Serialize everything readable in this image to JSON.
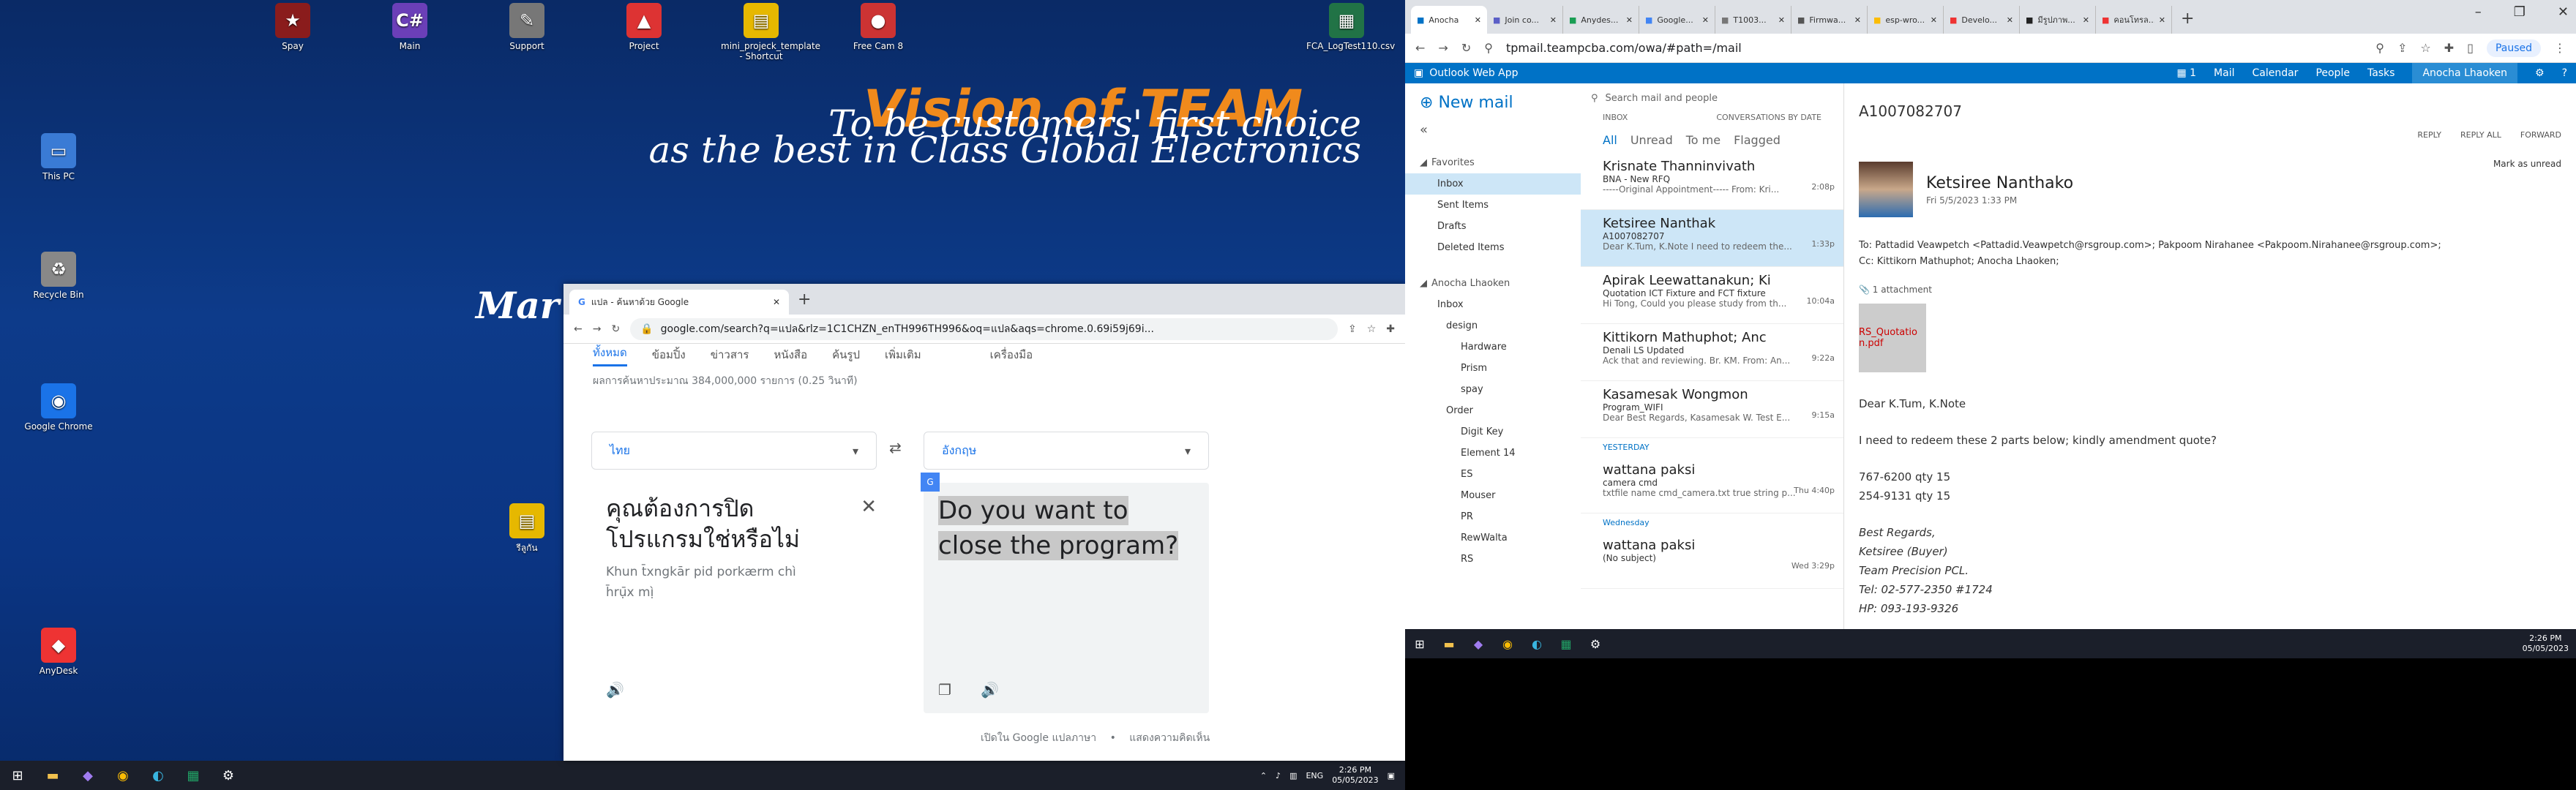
{
  "desktop": {
    "icons": [
      {
        "label": "Spay",
        "glyph": "★",
        "color": "#8a1c1c"
      },
      {
        "label": "Main",
        "glyph": "C#",
        "color": "#6b3fb8"
      },
      {
        "label": "Support",
        "glyph": "✎",
        "color": "#777"
      },
      {
        "label": "Project",
        "glyph": "▲",
        "color": "#d33"
      },
      {
        "label": "mini_projeck_template - Shortcut",
        "glyph": "▤",
        "color": "#e6b800"
      },
      {
        "label": "Free Cam 8",
        "glyph": "●",
        "color": "#c33"
      },
      {
        "label": "FCA_LogTest110.csv",
        "glyph": "▦",
        "color": "#217346"
      },
      {
        "label": "This PC",
        "glyph": "▭",
        "color": "#3a7bd5"
      },
      {
        "label": "Recycle Bin",
        "glyph": "♻",
        "color": "#888"
      },
      {
        "label": "Google Chrome",
        "glyph": "◉",
        "color": "#1a73e8"
      },
      {
        "label": "รีลูกัน",
        "glyph": "▤",
        "color": "#e6b800"
      },
      {
        "label": "AnyDesk",
        "glyph": "◆",
        "color": "#e33"
      }
    ],
    "wallpaper": {
      "headline": "Vision of TEAM",
      "line1": "To be customers' first choice",
      "line2": "as the best in Class Global Electronics",
      "line3": "Mar"
    }
  },
  "translate_window": {
    "tab_title": "แปล - ค้นหาด้วย Google",
    "url": "google.com/search?q=แปล&rlz=1C1CHZN_enTH996TH996&oq=แปล&aqs=chrome.0.69i59j69i...",
    "nav": [
      "ทั้งหมด",
      "ข้อมปิ้ง",
      "ข่าวสาร",
      "หนังสือ",
      "ค้นรูป",
      "เพิ่มเติม",
      "เครื่องมือ"
    ],
    "stats": "ผลการค้นหาประมาณ 384,000,000 รายการ (0.25 วินาที)",
    "source_lang": "ไทย",
    "target_lang": "อังกฤษ",
    "source_text": "คุณต้องการปิดโปรแกรมใช่หรือไม่",
    "transliteration": "Khun t̄xngkār pid porkærm chı̀ h̄rụ̄x mị̀",
    "translated_text": "Do you want to close the program?",
    "footer_open": "เปิดใน Google แปลภาษา",
    "footer_feedback": "แสดงความคิดเห็น"
  },
  "left_taskbar": {
    "time": "2:26 PM",
    "date": "05/05/2023",
    "lang": "ENG"
  },
  "right_browser": {
    "tabs": [
      "Anocha",
      "Join co...",
      "Anydes...",
      "Google...",
      "T1003...",
      "Firmwa...",
      "esp-wro...",
      "Develo...",
      "มีรูปภาพ...",
      "คอนโทรล..."
    ],
    "url": "tpmail.teampcba.com/owa/#path=/mail",
    "paused_label": "Paused"
  },
  "owa": {
    "app_title": "Outlook Web App",
    "nav": [
      "Mail",
      "Calendar",
      "People",
      "Tasks"
    ],
    "user": "Anocha Lhaoken",
    "new_mail": "New mail",
    "favorites_label": "Favorites",
    "favorites": [
      "Inbox",
      "Sent Items",
      "Drafts",
      "Deleted Items"
    ],
    "account": "Anocha Lhaoken",
    "tree": [
      "Inbox",
      "design",
      "Hardware",
      "Prism",
      "spay",
      "Order",
      "Digit Key",
      "Element 14",
      "ES",
      "Mouser",
      "PR",
      "RewWalta",
      "RS"
    ],
    "search_placeholder": "Search mail and people",
    "list_inbox": "INBOX",
    "list_sort": "CONVERSATIONS BY DATE",
    "filters": [
      "All",
      "Unread",
      "To me",
      "Flagged"
    ],
    "messages": [
      {
        "from": "Krisnate Thanninvivath",
        "subject": "BNA - New RFQ",
        "preview": "-----Original Appointment----- From: Kri...",
        "time": "2:08p"
      },
      {
        "from": "Ketsiree Nanthak",
        "subject": "A1007082707",
        "preview": "Dear K.Tum, K.Note I need to redeem the...",
        "time": "1:33p"
      },
      {
        "from": "Apirak Leewattanakun; Ki",
        "subject": "Quotation ICT Fixture and FCT fixture",
        "preview": "Hi Tong, Could you please study from th...",
        "time": "10:04a"
      },
      {
        "from": "Kittikorn Mathuphot; Anc",
        "subject": "Denali LS Updated",
        "preview": "Ack that and reviewing. Br. KM. From: An...",
        "time": "9:22a"
      },
      {
        "from": "Kasamesak Wongmon",
        "subject": "Program_WIFI",
        "preview": "Dear Best Regards, Kasamesak W. Test E...",
        "time": "9:15a"
      }
    ],
    "yesterday_label": "YESTERDAY",
    "yesterday_msg": {
      "from": "wattana paksi",
      "subject": "camera cmd",
      "preview": "txtfile name cmd_camera.txt true string p...",
      "time": "Thu 4:40p"
    },
    "wednesday_label": "Wednesday",
    "wednesday_msg": {
      "from": "wattana paksi",
      "subject": "(No subject)",
      "preview": "",
      "time": "Wed 3:29p"
    },
    "reading": {
      "subject": "A1007082707",
      "actions": [
        "REPLY",
        "REPLY ALL",
        "FORWARD"
      ],
      "mark_unread": "Mark as unread",
      "sender": "Ketsiree Nanthako",
      "date": "Fri 5/5/2023 1:33 PM",
      "to": "To:  Pattadid Veawpetch <Pattadid.Veawpetch@rsgroup.com>;  Pakpoom Nirahanee <Pakpoom.Nirahanee@rsgroup.com>;",
      "cc": "Cc:  Kittikorn Mathuphot;  Anocha Lhaoken;",
      "attachments": "1 attachment",
      "attachment_name": "RS_Quotatio n.pdf",
      "greeting": "Dear K.Tum, K.Note",
      "line1": "I need to redeem these 2 parts below; kindly amendment quote?",
      "part1": "767-6200 qty 15",
      "part2": "254-9131 qty 15",
      "sig1": "Best Regards,",
      "sig2": "Ketsiree (Buyer)",
      "sig3": "Team Precision PCL.",
      "sig4": "Tel: 02-577-2350 #1724",
      "sig5": "HP: 093-193-9326"
    }
  },
  "right_taskbar": {
    "time": "2:26 PM",
    "date": "05/05/2023"
  }
}
